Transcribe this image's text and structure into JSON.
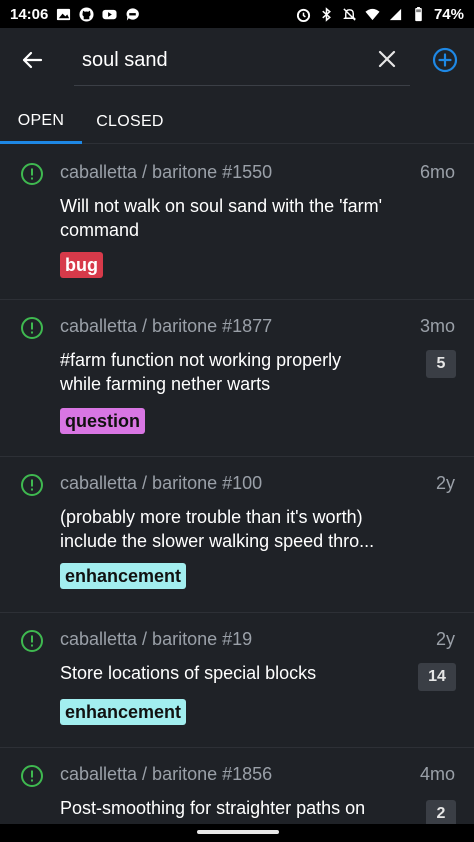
{
  "status_bar": {
    "time": "14:06",
    "battery": "74%",
    "left_icons": [
      "image-icon",
      "github-icon",
      "youtube-icon",
      "chat-icon"
    ],
    "right_icons": [
      "alarm-icon",
      "bluetooth-icon",
      "mute-icon",
      "wifi-icon",
      "signal-icon",
      "battery-icon"
    ]
  },
  "search": {
    "query": "soul sand"
  },
  "tabs": [
    {
      "label": "OPEN",
      "active": true
    },
    {
      "label": "CLOSED",
      "active": false
    }
  ],
  "colors": {
    "background": "#1f2227",
    "accent": "#1e88e5",
    "open_icon": "#3fb950",
    "muted_text": "#9aa0a8"
  },
  "issues": [
    {
      "repo": "caballetta / baritone #1550",
      "age": "6mo",
      "title_line1": "Will not walk on soul sand with the 'farm'",
      "title_line2": "command",
      "labels": [
        {
          "name": "bug"
        }
      ],
      "comments": ""
    },
    {
      "repo": "caballetta / baritone #1877",
      "age": "3mo",
      "title_line1": "#farm function not working properly",
      "title_line2": "while farming nether warts",
      "labels": [
        {
          "name": "question"
        }
      ],
      "comments": "5"
    },
    {
      "repo": "caballetta / baritone #100",
      "age": "2y",
      "title_line1": "(probably more trouble than it's worth)",
      "title_line2": "include the slower walking speed thro...",
      "labels": [
        {
          "name": "enhancement"
        }
      ],
      "comments": ""
    },
    {
      "repo": "caballetta / baritone #19",
      "age": "2y",
      "title_line1": "Store locations of special blocks",
      "title_line2": "",
      "labels": [
        {
          "name": "enhancement"
        }
      ],
      "comments": "14"
    },
    {
      "repo": "caballetta / baritone #1856",
      "age": "4mo",
      "title_line1": "Post-smoothing for straighter paths on",
      "title_line2": "",
      "labels": [],
      "comments": "2"
    }
  ]
}
